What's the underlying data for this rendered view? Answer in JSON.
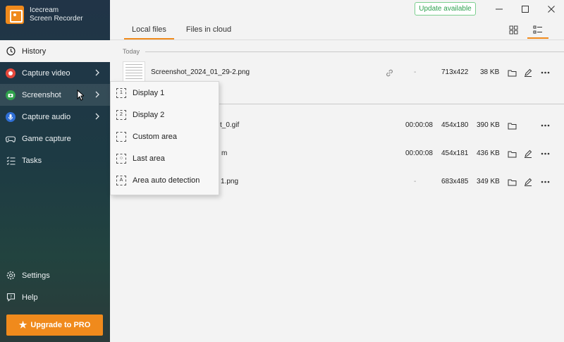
{
  "app": {
    "name_line1": "Icecream",
    "name_line2": "Screen Recorder",
    "update_label": "Update available",
    "window_controls": [
      "minimize-icon",
      "maximize-icon",
      "close-icon"
    ],
    "accent_color": "#f08a1c"
  },
  "sidebar": {
    "items": [
      {
        "label": "History",
        "icon": "clock-icon",
        "active": true
      },
      {
        "label": "Capture video",
        "icon": "record-icon",
        "has_submenu": true
      },
      {
        "label": "Screenshot",
        "icon": "camera-icon",
        "has_submenu": true,
        "hovered": true
      },
      {
        "label": "Capture audio",
        "icon": "microphone-icon",
        "has_submenu": true
      },
      {
        "label": "Game capture",
        "icon": "gamepad-icon"
      },
      {
        "label": "Tasks",
        "icon": "tasks-icon"
      }
    ],
    "bottom_items": [
      {
        "label": "Settings",
        "icon": "gear-icon"
      },
      {
        "label": "Help",
        "icon": "help-icon"
      }
    ],
    "upgrade_label": "Upgrade to PRO"
  },
  "tabs": [
    {
      "label": "Local files",
      "active": true
    },
    {
      "label": "Files in cloud",
      "active": false
    }
  ],
  "sections": {
    "today_label": "Today"
  },
  "files": [
    {
      "name": "Screenshot_2024_01_29-2.png",
      "duration": "-",
      "resolution": "713x422",
      "size": "38 KB",
      "link": true,
      "edit": true
    },
    {
      "name": "t_0.gif",
      "duration": "00:00:08",
      "resolution": "454x180",
      "size": "390 KB",
      "link": false,
      "edit": false
    },
    {
      "name": "m",
      "duration": "00:00:08",
      "resolution": "454x181",
      "size": "436 KB",
      "link": false,
      "edit": true
    },
    {
      "name": "1.png",
      "duration": "-",
      "resolution": "683x485",
      "size": "349 KB",
      "link": false,
      "edit": true
    }
  ],
  "screenshot_menu": {
    "items": [
      {
        "label": "Display 1",
        "glyph": "1"
      },
      {
        "label": "Display 2",
        "glyph": "2"
      },
      {
        "label": "Custom area",
        "glyph": ""
      },
      {
        "label": "Last area",
        "glyph": "○"
      },
      {
        "label": "Area auto detection",
        "glyph": "A"
      }
    ]
  }
}
